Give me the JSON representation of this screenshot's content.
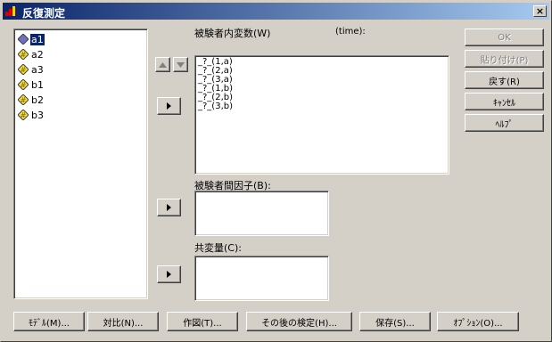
{
  "window": {
    "title": "反復測定",
    "close_glyph": "×"
  },
  "variables": [
    {
      "name": "a1",
      "selected": true
    },
    {
      "name": "a2",
      "selected": false
    },
    {
      "name": "a3",
      "selected": false
    },
    {
      "name": "b1",
      "selected": false
    },
    {
      "name": "b2",
      "selected": false
    },
    {
      "name": "b3",
      "selected": false
    }
  ],
  "within": {
    "label": "被験者内変数(W)",
    "factor_hint": "(time):",
    "items": [
      "_?_(1,a)",
      "_?_(2,a)",
      "_?_(3,a)",
      "_?_(1,b)",
      "_?_(2,b)",
      "_?_(3,b)"
    ]
  },
  "between": {
    "label": "被験者間因子(B):"
  },
  "covariates": {
    "label": "共変量(C):"
  },
  "right_buttons": {
    "ok": "OK",
    "paste": "貼り付け(P)",
    "reset": "戻す(R)",
    "cancel": "ｷｬﾝｾﾙ",
    "help": "ﾍﾙﾌﾟ"
  },
  "bottom_buttons": {
    "model": "ﾓﾃﾞﾙ(M)...",
    "contrast": "対比(N)...",
    "plots": "作図(T)...",
    "posthoc": "その後の検定(H)...",
    "save": "保存(S)...",
    "options": "ｵﾌﾟｼｮﾝ(O)..."
  },
  "icons": {
    "variable_scale": "scale-diamond-icon",
    "move_arrow": "right-arrow-icon",
    "up_arrow": "up-arrow-icon",
    "down_arrow": "down-arrow-icon"
  }
}
